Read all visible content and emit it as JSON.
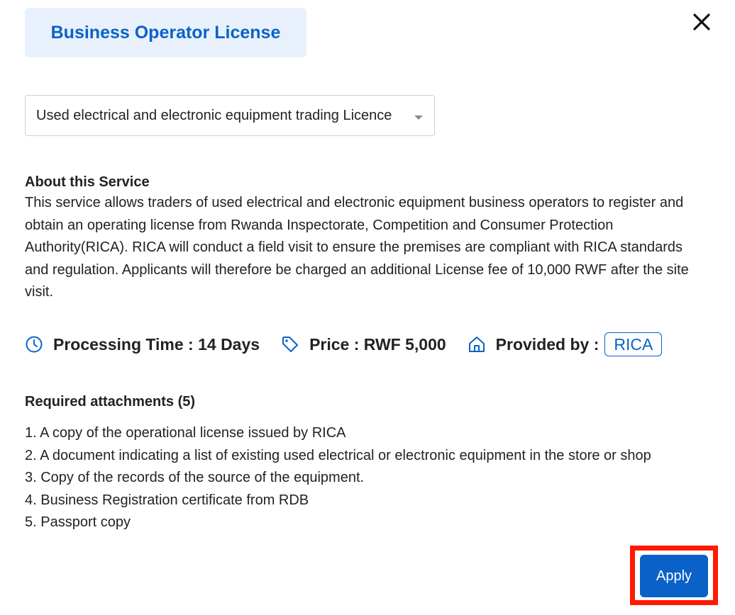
{
  "header": {
    "title": "Business Operator License"
  },
  "license_select": {
    "selected": "Used electrical and electronic equipment trading Licence"
  },
  "about": {
    "heading": "About this Service",
    "body": "This service allows traders of used electrical and electronic equipment business operators to register and obtain an operating license from Rwanda Inspectorate, Competition and Consumer Protection Authority(RICA). RICA will conduct a field visit to ensure the premises are compliant with RICA standards and regulation. Applicants will therefore be charged an additional License fee of 10,000 RWF after the site visit."
  },
  "meta": {
    "processing_time": "Processing Time : 14 Days",
    "price": "Price : RWF 5,000",
    "provided_by_label": "Provided by :",
    "provider": "RICA"
  },
  "attachments": {
    "heading": "Required attachments (5)",
    "items": [
      "1. A copy of the operational license issued by RICA",
      "2. A document indicating a list of existing used electrical or electronic equipment in the store or shop",
      "3. Copy of the records of the source of the equipment.",
      "4. Business Registration certificate from RDB",
      "5. Passport copy"
    ]
  },
  "actions": {
    "apply_label": "Apply"
  },
  "icons": {
    "close": "close-icon",
    "clock": "clock-icon",
    "price_tag": "tag-icon",
    "provider": "home-icon",
    "dropdown": "chevron-down-icon"
  },
  "colors": {
    "accent": "#0a62c9",
    "chip_bg": "#e8f1fb",
    "highlight": "#ff1a00"
  }
}
